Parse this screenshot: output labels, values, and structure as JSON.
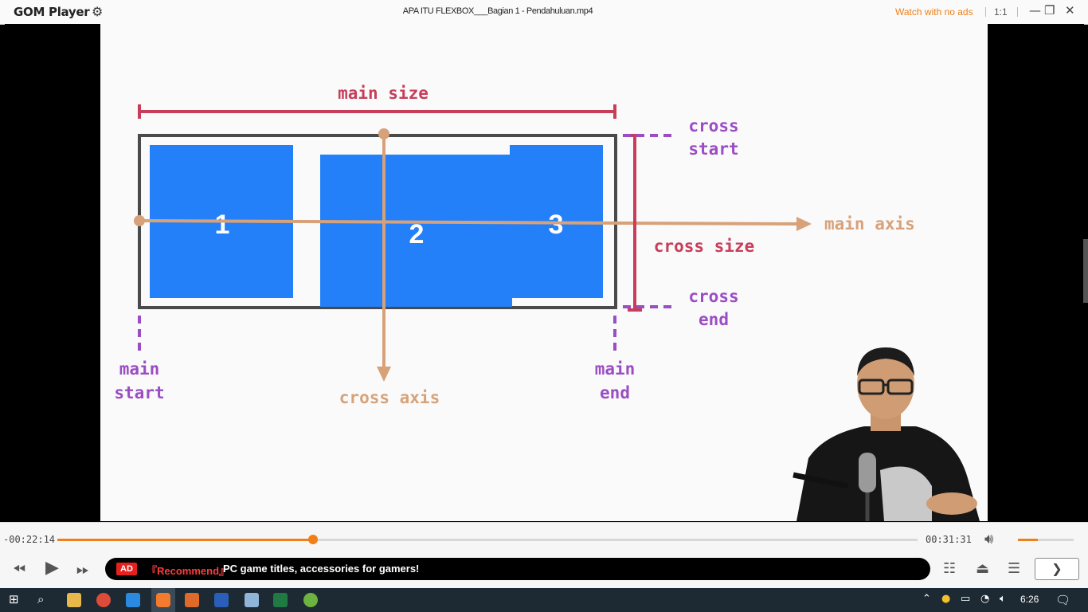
{
  "app": {
    "name": "GOM Player",
    "window_title": "APA ITU FLEXBOX___Bagian 1 - Pendahuluan.mp4",
    "watch_no_ads": "Watch with no ads",
    "aspect_ratio": "1:1"
  },
  "slide": {
    "main_size": "main size",
    "cross_start_1": "cross",
    "cross_start_2": "start",
    "main_axis": "main axis",
    "cross_size": "cross size",
    "cross_end_1": "cross",
    "cross_end_2": "end",
    "main_start_1": "main",
    "main_start_2": "start",
    "cross_axis": "cross axis",
    "main_end_1": "main",
    "main_end_2": "end",
    "item1": "1",
    "item2": "2",
    "item3": "3"
  },
  "playback": {
    "current_time": "-00:22:14",
    "total_time": "00:31:31",
    "progress": 0.297,
    "volume": 0.35
  },
  "ad": {
    "badge": "AD",
    "recommend": "『Recommend』",
    "text": "PC game titles, accessories for gamers!"
  },
  "taskbar": {
    "clock": "6:26"
  },
  "colors": {
    "accent": "#f07f17",
    "flex_blue": "#2480f8",
    "axis_tan": "#d7a27a",
    "size_red": "#c73e5b",
    "label_purple": "#9b4dc4"
  }
}
